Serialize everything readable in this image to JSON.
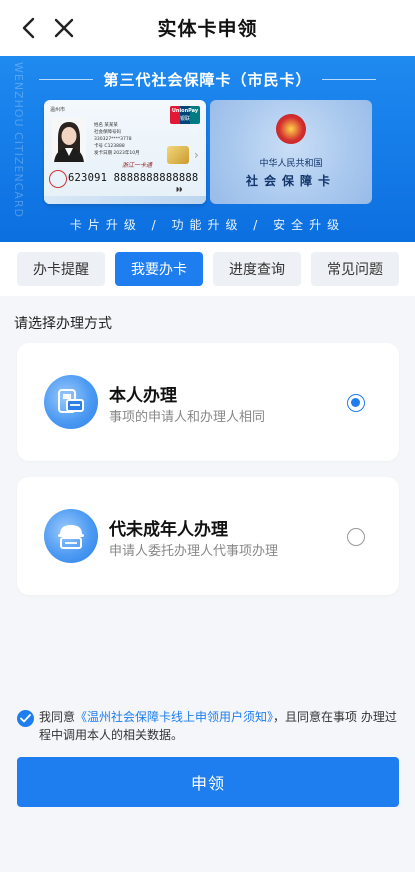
{
  "header": {
    "title": "实体卡申领",
    "back_icon": "chevron-left-icon",
    "close_icon": "close-icon"
  },
  "banner": {
    "side_text": "WENZHOU CITIZENCARD",
    "title": "第三代社会保障卡（市民卡）",
    "footer": "卡片升级 / 功能升级 / 安全升级",
    "card_front": {
      "top_label": "温州市",
      "info_lines": [
        "姓名 某某某",
        "社会保障号码 330327****3778",
        "卡号 C123888",
        "发卡日期 2023年10月"
      ],
      "union_top": "UnionPay",
      "union_bottom": "银联",
      "signature": "浙江一卡通",
      "card_number": "623091 8888888888888"
    },
    "card_back": {
      "line1": "中华人民共和国",
      "line2": "社会保障卡"
    }
  },
  "tabs": [
    {
      "label": "办卡提醒",
      "active": false
    },
    {
      "label": "我要办卡",
      "active": true
    },
    {
      "label": "进度查询",
      "active": false
    },
    {
      "label": "常见问题",
      "active": false
    }
  ],
  "section_label": "请选择办理方式",
  "options": [
    {
      "title": "本人办理",
      "desc": "事项的申请人和办理人相同",
      "checked": true,
      "icon": "id-card-icon"
    },
    {
      "title": "代未成年人办理",
      "desc": "申请人委托办理人代事项办理",
      "checked": false,
      "icon": "minor-proxy-icon"
    }
  ],
  "agreement": {
    "prefix": "我同意",
    "link": "《温州社会保障卡线上申领用户须知》",
    "suffix": "，且同意在事项 办理过程中调用本人的相关数据。",
    "checked": true
  },
  "submit_label": "申领",
  "colors": {
    "accent": "#1e7ef0",
    "banner": "#1683ef",
    "background": "#f4f6f9"
  }
}
